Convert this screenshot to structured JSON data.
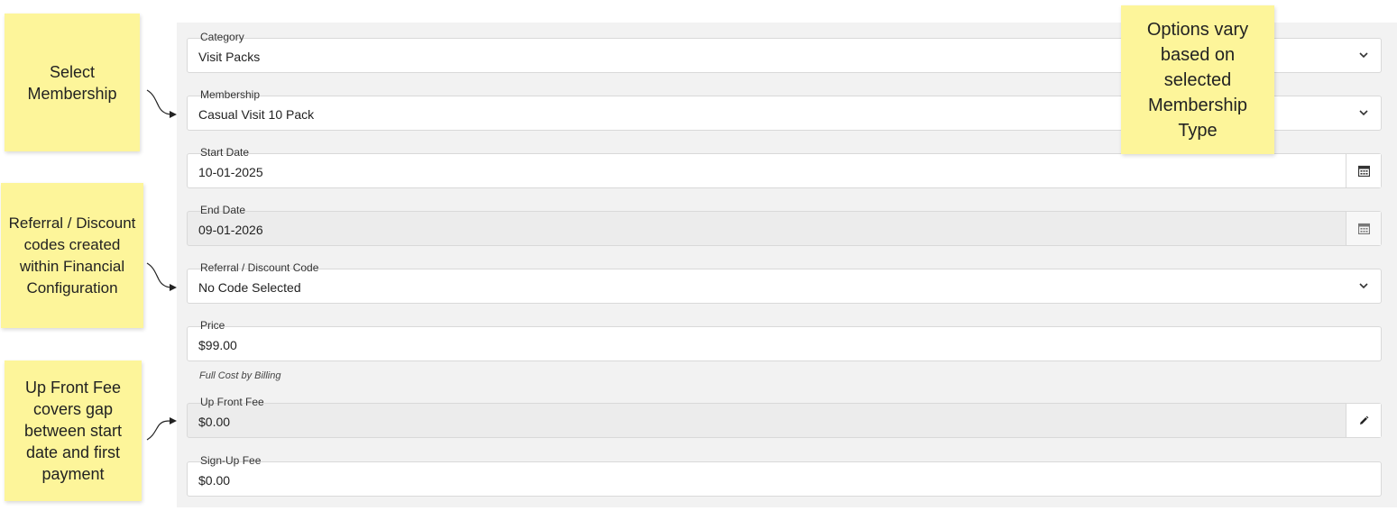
{
  "form": {
    "fields": [
      {
        "label": "Category",
        "value": "Visit Packs",
        "control": "select"
      },
      {
        "label": "Membership",
        "value": "Casual Visit 10 Pack",
        "control": "select"
      },
      {
        "label": "Start Date",
        "value": "10-01-2025",
        "control": "date"
      },
      {
        "label": "End Date",
        "value": "09-01-2026",
        "control": "date-disabled"
      },
      {
        "label": "Referral / Discount Code",
        "value": "No Code Selected",
        "control": "select"
      },
      {
        "label": "Price",
        "value": "$99.00",
        "control": "text"
      },
      {
        "label": "Up Front Fee",
        "value": "$0.00",
        "control": "text-editable"
      },
      {
        "label": "Sign-Up Fee",
        "value": "$0.00",
        "control": "text"
      }
    ],
    "price_helper": "Full Cost by Billing"
  },
  "annotations": {
    "select_membership": "Select Membership",
    "referral_codes": "Referral / Discount codes created within Financial Configuration",
    "up_front_fee": "Up Front Fee covers gap between start date and first payment",
    "options_vary": "Options vary based on selected Membership Type"
  },
  "icons": {
    "select": "chevron-down-icon",
    "date": "calendar-icon",
    "edit": "pencil-icon"
  },
  "colors": {
    "sticky_note": "#fdf59a",
    "panel_background": "#f2f2f2",
    "disabled_field": "#ececec"
  }
}
